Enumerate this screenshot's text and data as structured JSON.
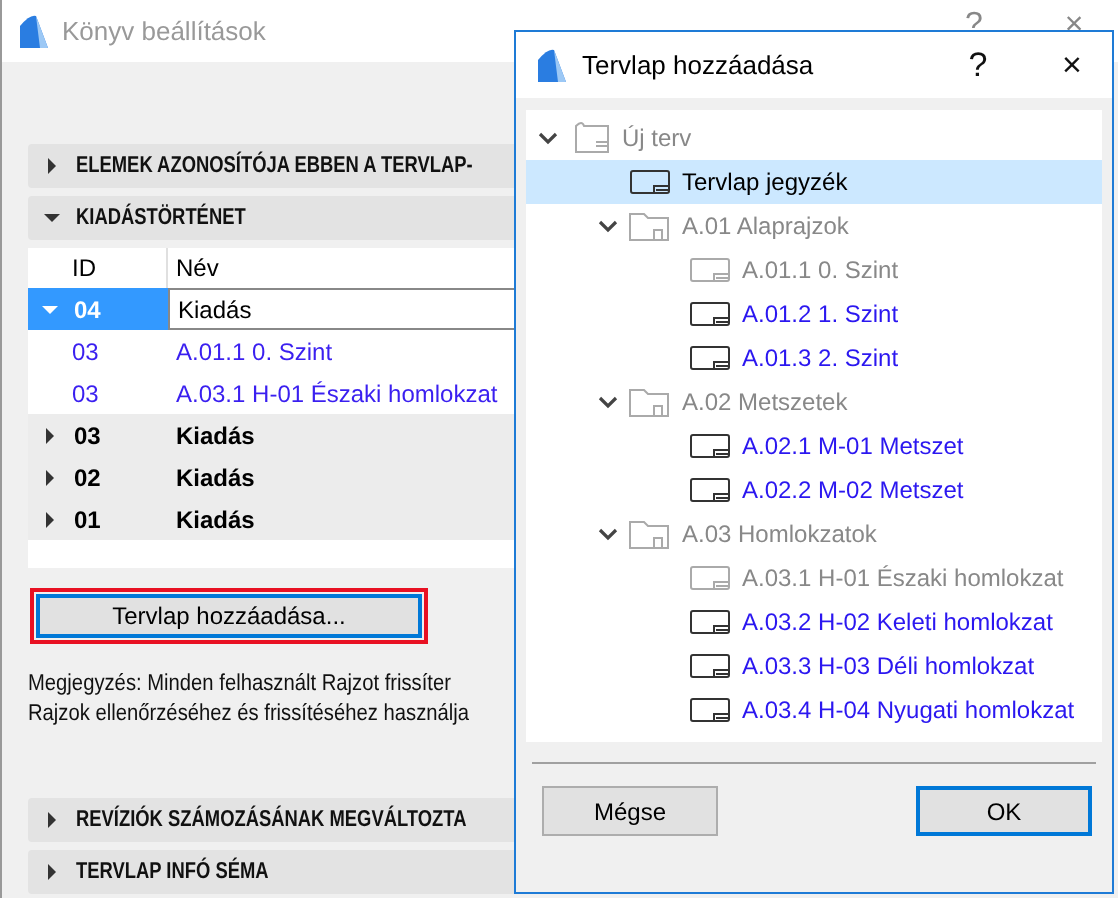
{
  "background_window": {
    "title": "Könyv beállítások",
    "help": "?",
    "close": "×",
    "sections_top": [
      {
        "label": "ELEMEK AZONOSÍTÓJA EBBEN A TERVLAP-",
        "expanded": false
      },
      {
        "label": "KIADÁSTÖRTÉNET",
        "expanded": true
      }
    ],
    "table": {
      "columns": [
        "ID",
        "Név"
      ],
      "rows": [
        {
          "kind": "issue",
          "id": "04",
          "name": "Kiadás",
          "expanded": true,
          "selected": true
        },
        {
          "kind": "sheet",
          "id": "03",
          "name": "A.01.1 0. Szint",
          "selected": false
        },
        {
          "kind": "sheet",
          "id": "03",
          "name": "A.03.1 H-01 Északi homlokzat",
          "selected": false
        },
        {
          "kind": "issue",
          "id": "03",
          "name": "Kiadás",
          "expanded": false,
          "selected": false
        },
        {
          "kind": "issue",
          "id": "02",
          "name": "Kiadás",
          "expanded": false,
          "selected": false
        },
        {
          "kind": "issue",
          "id": "01",
          "name": "Kiadás",
          "expanded": false,
          "selected": false
        }
      ]
    },
    "add_button": {
      "label": "Tervlap hozzáadása...",
      "highlighted": true
    },
    "note": [
      "Megjegyzés: Minden felhasznált Rajzot frissíter",
      "Rajzok ellenőrzéséhez és frissítéséhez használja"
    ],
    "sections_bottom": [
      {
        "label": "REVÍZIÓK SZÁMOZÁSÁNAK MEGVÁLTOZTA",
        "expanded": false
      },
      {
        "label": "TERVLAP INFÓ SÉMA",
        "expanded": false
      }
    ]
  },
  "dialog": {
    "title": "Tervlap hozzáadása",
    "help": "?",
    "close": "×",
    "tree": [
      {
        "kind": "project",
        "label": "Új terv",
        "expanded": true,
        "disabled": true,
        "selected": false,
        "children": [
          {
            "kind": "sheet",
            "label": "Tervlap jegyzék",
            "disabled": false,
            "selected": true
          },
          {
            "kind": "folder",
            "label": "A.01 Alaprajzok",
            "expanded": true,
            "disabled": true,
            "selected": false,
            "children": [
              {
                "kind": "sheet",
                "label": "A.01.1 0. Szint",
                "disabled": true,
                "selected": false
              },
              {
                "kind": "sheet",
                "label": "A.01.2 1. Szint",
                "disabled": false,
                "selected": false
              },
              {
                "kind": "sheet",
                "label": "A.01.3 2. Szint",
                "disabled": false,
                "selected": false
              }
            ]
          },
          {
            "kind": "folder",
            "label": "A.02 Metszetek",
            "expanded": true,
            "disabled": true,
            "selected": false,
            "children": [
              {
                "kind": "sheet",
                "label": "A.02.1 M-01 Metszet",
                "disabled": false,
                "selected": false
              },
              {
                "kind": "sheet",
                "label": "A.02.2 M-02 Metszet",
                "disabled": false,
                "selected": false
              }
            ]
          },
          {
            "kind": "folder",
            "label": "A.03 Homlokzatok",
            "expanded": true,
            "disabled": true,
            "selected": false,
            "children": [
              {
                "kind": "sheet",
                "label": "A.03.1 H-01 Északi homlokzat",
                "disabled": true,
                "selected": false
              },
              {
                "kind": "sheet",
                "label": "A.03.2 H-02 Keleti homlokzat",
                "disabled": false,
                "selected": false
              },
              {
                "kind": "sheet",
                "label": "A.03.3 H-03 Déli homlokzat",
                "disabled": false,
                "selected": false
              },
              {
                "kind": "sheet",
                "label": "A.03.4 H-04 Nyugati homlokzat",
                "disabled": false,
                "selected": false
              }
            ]
          }
        ]
      }
    ],
    "buttons": [
      {
        "label": "Mégse",
        "default": false
      },
      {
        "label": "OK",
        "default": true
      }
    ]
  }
}
